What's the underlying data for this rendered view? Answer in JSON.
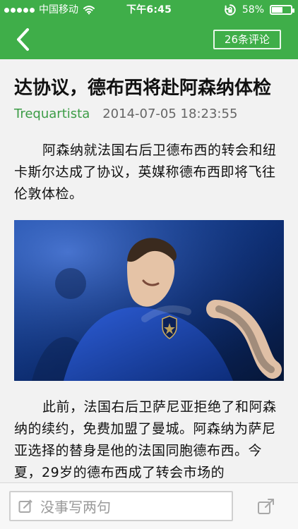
{
  "status_bar": {
    "carrier": "中国移动",
    "time": "下午6:45",
    "battery_percent": "58%",
    "battery_level": 0.58,
    "signal_dots_filled": 5,
    "colors": {
      "bar": "#3fae49",
      "text": "#ffffff"
    },
    "icons": {
      "wifi": "wifi-icon",
      "rotation_lock": "rotation-lock-icon",
      "battery": "battery-icon"
    }
  },
  "nav": {
    "back_icon": "chevron-left-icon",
    "comments_label": "26条评论"
  },
  "article": {
    "title": "达协议，德布西将赴阿森纳体检",
    "author": "Trequartista",
    "timestamp": "2014-07-05 18:23:55",
    "paragraphs": [
      "阿森纳就法国右后卫德布西的转会和纽卡斯尔达成了协议，英媒称德布西即将飞往伦敦体检。",
      "此前，法国右后卫萨尼亚拒绝了和阿森纳的续约，免费加盟了曼城。阿森纳为萨尼亚选择的替身是他的法国同胞德布西。今夏，29岁的德布西成了转会市场的"
    ],
    "image_icon": "player-photo"
  },
  "bottom_bar": {
    "comment_placeholder": "没事写两句",
    "edit_icon": "edit-icon",
    "share_icon": "share-icon"
  },
  "colors": {
    "brand_green": "#3fae49",
    "author_green": "#3c9c46",
    "background": "#f2f2f2"
  }
}
